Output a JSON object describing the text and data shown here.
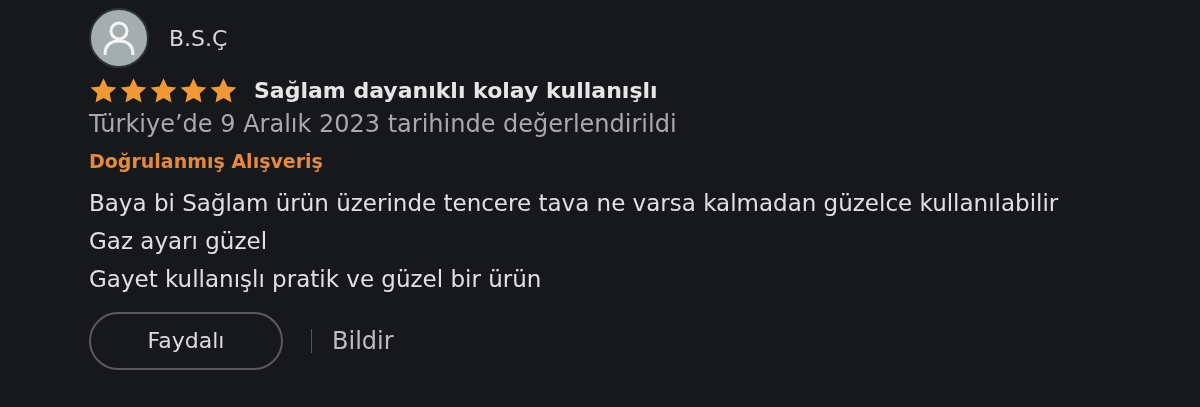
{
  "review": {
    "author": "B.S.Ç",
    "stars": 5,
    "title": "Sağlam dayanıklı kolay kullanışlı",
    "date": "Türkiye’de 9 Aralık 2023 tarihinde değerlendirildi",
    "badge": "Doğrulanmış Alışveriş",
    "body": [
      "Baya bi Sağlam ürün üzerinde tencere tava ne varsa kalmadan güzelce kullanılabilir",
      "Gaz ayarı güzel",
      "Gayet kullanışlı pratik ve güzel bir ürün"
    ],
    "helpful_button": "Faydalı",
    "report_link": "Bildir"
  }
}
